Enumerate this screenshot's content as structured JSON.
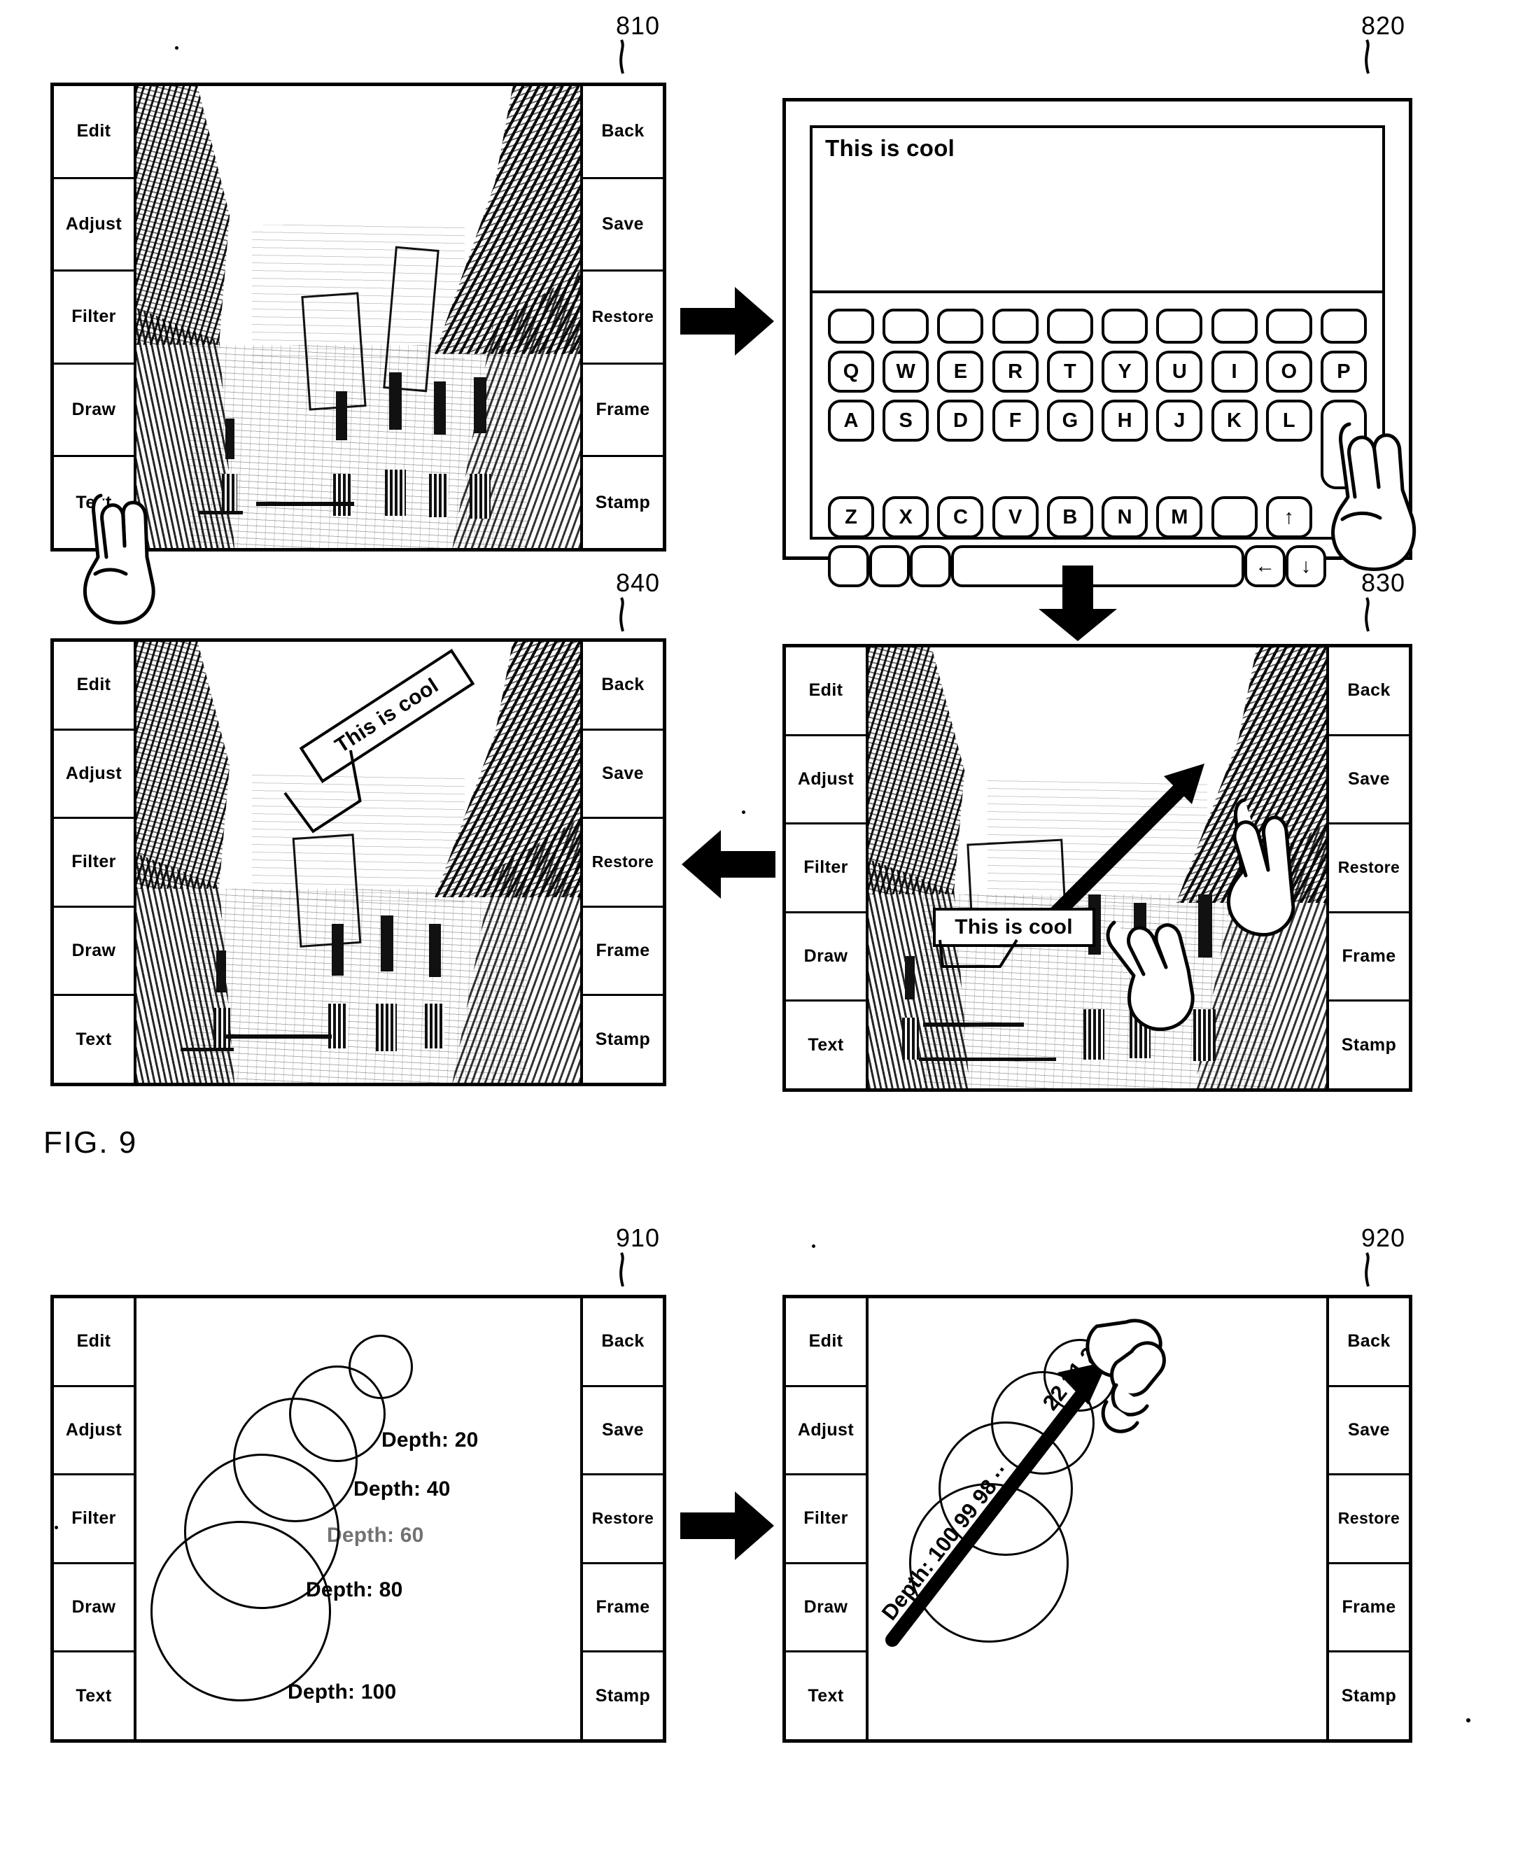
{
  "figure": {
    "caption_9": "FIG. 9",
    "reference_numbers": {
      "p810": "810",
      "p820": "820",
      "p830": "830",
      "p840": "840",
      "p910": "910",
      "p920": "920"
    }
  },
  "menus": {
    "left_items": [
      "Edit",
      "Adjust",
      "Filter",
      "Draw",
      "Text"
    ],
    "right_items": [
      "Back",
      "Save",
      "Restore",
      "Frame",
      "Stamp"
    ]
  },
  "panel_810": {
    "id": "810",
    "active_left_item": "Text",
    "gesture": "tap-on-text-button"
  },
  "panel_820": {
    "id": "820",
    "typed_text": "This is cool",
    "keyboard": {
      "row0": [
        "",
        "",
        "",
        "",
        "",
        "",
        "",
        "",
        "",
        ""
      ],
      "row1": [
        "Q",
        "W",
        "E",
        "R",
        "T",
        "Y",
        "U",
        "I",
        "O",
        "P"
      ],
      "row2": [
        "A",
        "S",
        "D",
        "F",
        "G",
        "H",
        "J",
        "K",
        "L"
      ],
      "row2_tall_key": "",
      "row3": [
        "Z",
        "X",
        "C",
        "V",
        "B",
        "N",
        "M",
        ""
      ],
      "row3_up_arrow": "↑",
      "row4_blanks": [
        "",
        "",
        ""
      ],
      "row4_space": "",
      "row4_backspace": "←",
      "row4_down_arrow": "↓"
    },
    "gesture": "tap-enter-key"
  },
  "panel_830": {
    "id": "830",
    "text_box_label": "This is cool",
    "gesture": "two-finger-drag-rotate"
  },
  "panel_840": {
    "id": "840",
    "text_box_label": "This is cool",
    "rotation_degrees": -33
  },
  "panel_910": {
    "id": "910",
    "depth_labels": [
      {
        "text": "Depth: 20",
        "value": 20,
        "faint": false
      },
      {
        "text": "Depth: 40",
        "value": 40,
        "faint": false
      },
      {
        "text": "Depth: 60",
        "value": 60,
        "faint": true
      },
      {
        "text": "Depth: 80",
        "value": 80,
        "faint": false
      },
      {
        "text": "Depth: 100",
        "value": 100,
        "faint": false
      }
    ]
  },
  "panel_920": {
    "id": "920",
    "rotated_label_start": "Depth: 100 99 98 ··",
    "rotated_label_end": "22 21 21",
    "gesture": "drag-along-depth-axis"
  },
  "colors": {
    "ink": "#000000",
    "paper": "#ffffff"
  }
}
